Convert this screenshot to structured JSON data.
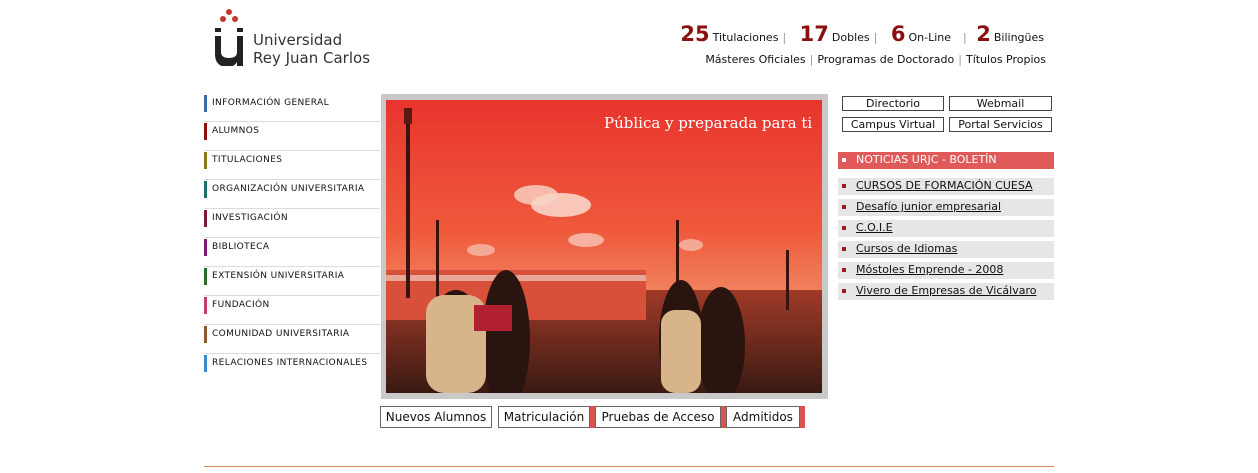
{
  "logo": {
    "line1": "Universidad",
    "line2": "Rey Juan Carlos",
    "brand_color": "#b5181e"
  },
  "stats": [
    {
      "num": "25",
      "label": "Titulaciones",
      "sep": "|"
    },
    {
      "num": "17",
      "label": "Dobles",
      "sep": "|"
    },
    {
      "num": "6",
      "label": "On-Line",
      "sep": "|"
    },
    {
      "num": "2",
      "label": "Bilingües",
      "sep": ""
    }
  ],
  "sublinks": [
    "Másteres Oficiales",
    "Programas de Doctorado",
    "Títulos Propios"
  ],
  "nav": [
    {
      "label": "INFORMACIÓN GENERAL",
      "color": "#3a6ea5"
    },
    {
      "label": "ALUMNOS",
      "color": "#8b1111"
    },
    {
      "label": "TITULACIONES",
      "color": "#8a7a1a"
    },
    {
      "label": "ORGANIZACIÓN UNIVERSITARIA",
      "color": "#1f6e6e"
    },
    {
      "label": "INVESTIGACIÓN",
      "color": "#7a1a3a"
    },
    {
      "label": "BIBLIOTECA",
      "color": "#7a1a7a"
    },
    {
      "label": "EXTENSIÓN UNIVERSITARIA",
      "color": "#2a6a2a"
    },
    {
      "label": "FUNDACIÓN",
      "color": "#c0406a"
    },
    {
      "label": "COMUNIDAD UNIVERSITARIA",
      "color": "#8a5a2a"
    },
    {
      "label": "RELACIONES INTERNACIONALES",
      "color": "#3a8ad0"
    }
  ],
  "banner": {
    "slogan": "Pública y preparada para ti"
  },
  "quick_buttons": [
    "Nuevos Alumnos",
    "Matriculación",
    "Pruebas de Acceso",
    "Admitidos"
  ],
  "right_links": {
    "directorio": "Directorio",
    "webmail": "Webmail",
    "campus": "Campus Virtual",
    "portal": "Portal Servicios"
  },
  "news_header": "NOTICIAS URJC - BOLETÍN",
  "news": [
    "CURSOS DE FORMACIÓN CUESA",
    "Desafío junior empresarial",
    "C.O.I.E",
    "Cursos de Idiomas",
    "Móstoles Emprende - 2008",
    "Vivero de Empresas de Vicálvaro"
  ],
  "colors": {
    "accent": "#8b1111",
    "news_header_bg": "#e05a5a",
    "quick_edge": "#d9534f"
  }
}
